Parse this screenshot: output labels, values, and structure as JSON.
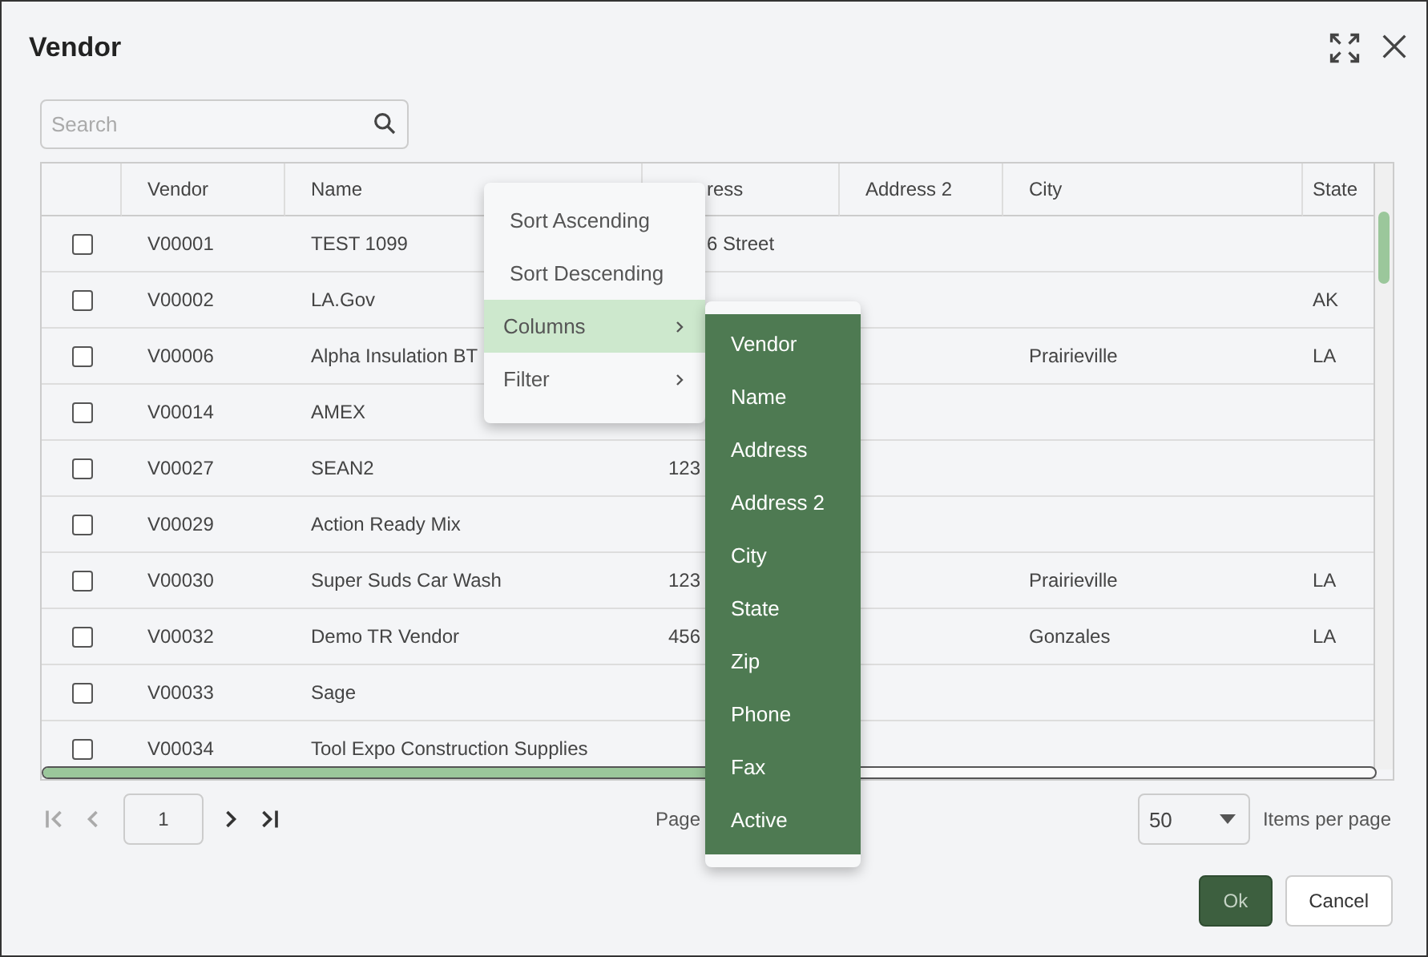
{
  "dialog": {
    "title": "Vendor"
  },
  "search": {
    "placeholder": "Search"
  },
  "table": {
    "columns": [
      {
        "label": "Vendor",
        "cut": false
      },
      {
        "label": "Name",
        "cut": false
      },
      {
        "label": "ress",
        "cut": true
      },
      {
        "label": "Address 2",
        "cut": false
      },
      {
        "label": "City",
        "cut": false
      },
      {
        "label": "State",
        "cut": false
      }
    ],
    "rows": [
      {
        "checked": false,
        "cells": [
          {
            "text": "V00001"
          },
          {
            "text": "TEST 1099"
          },
          {
            "text": "6 Street",
            "cut": true
          },
          null,
          null,
          null
        ]
      },
      {
        "checked": false,
        "cells": [
          {
            "text": "V00002"
          },
          {
            "text": "LA.Gov"
          },
          null,
          null,
          null,
          {
            "text": "AK"
          }
        ]
      },
      {
        "checked": false,
        "cells": [
          {
            "text": "V00006"
          },
          {
            "text": "Alpha Insulation BT"
          },
          null,
          null,
          {
            "text": "Prairieville"
          },
          {
            "text": "LA"
          }
        ]
      },
      {
        "checked": false,
        "cells": [
          {
            "text": "V00014"
          },
          {
            "text": "AMEX"
          },
          null,
          null,
          null,
          null
        ]
      },
      {
        "checked": false,
        "cells": [
          {
            "text": "V00027"
          },
          {
            "text": "SEAN2"
          },
          {
            "text": "123"
          },
          null,
          null,
          null
        ]
      },
      {
        "checked": false,
        "cells": [
          {
            "text": "V00029"
          },
          {
            "text": "Action Ready Mix"
          },
          null,
          null,
          null,
          null
        ]
      },
      {
        "checked": false,
        "cells": [
          {
            "text": "V00030"
          },
          {
            "text": "Super Suds Car Wash"
          },
          {
            "text": "123"
          },
          null,
          {
            "text": "Prairieville"
          },
          {
            "text": "LA"
          }
        ]
      },
      {
        "checked": false,
        "cells": [
          {
            "text": "V00032"
          },
          {
            "text": "Demo TR Vendor"
          },
          {
            "text": "456"
          },
          null,
          {
            "text": "Gonzales"
          },
          {
            "text": "LA"
          }
        ]
      },
      {
        "checked": false,
        "cells": [
          {
            "text": "V00033"
          },
          {
            "text": "Sage"
          },
          null,
          null,
          null,
          null
        ]
      },
      {
        "checked": false,
        "cells": [
          {
            "text": "V00034"
          },
          {
            "text": "Tool Expo Construction Supplies"
          },
          null,
          null,
          null,
          null
        ]
      }
    ]
  },
  "context_menu": {
    "items": [
      {
        "label": "Sort Ascending",
        "kind": "action",
        "selected": false
      },
      {
        "label": "Sort Descending",
        "kind": "action",
        "selected": false
      },
      {
        "label": "Columns",
        "kind": "submenu",
        "selected": true
      },
      {
        "label": "Filter",
        "kind": "submenu",
        "selected": false
      }
    ]
  },
  "columns_submenu": {
    "items": [
      "Vendor",
      "Name",
      "Address",
      "Address 2",
      "City",
      "State",
      "Zip",
      "Phone",
      "Fax",
      "Active"
    ]
  },
  "pager": {
    "first_disabled": true,
    "prev_disabled": true,
    "page": "1",
    "page_label": "Page",
    "page_size": "50",
    "page_size_label": "Items per page"
  },
  "buttons": [
    {
      "label": "Ok",
      "kind": "primary"
    },
    {
      "label": "Cancel",
      "kind": "secondary"
    }
  ]
}
